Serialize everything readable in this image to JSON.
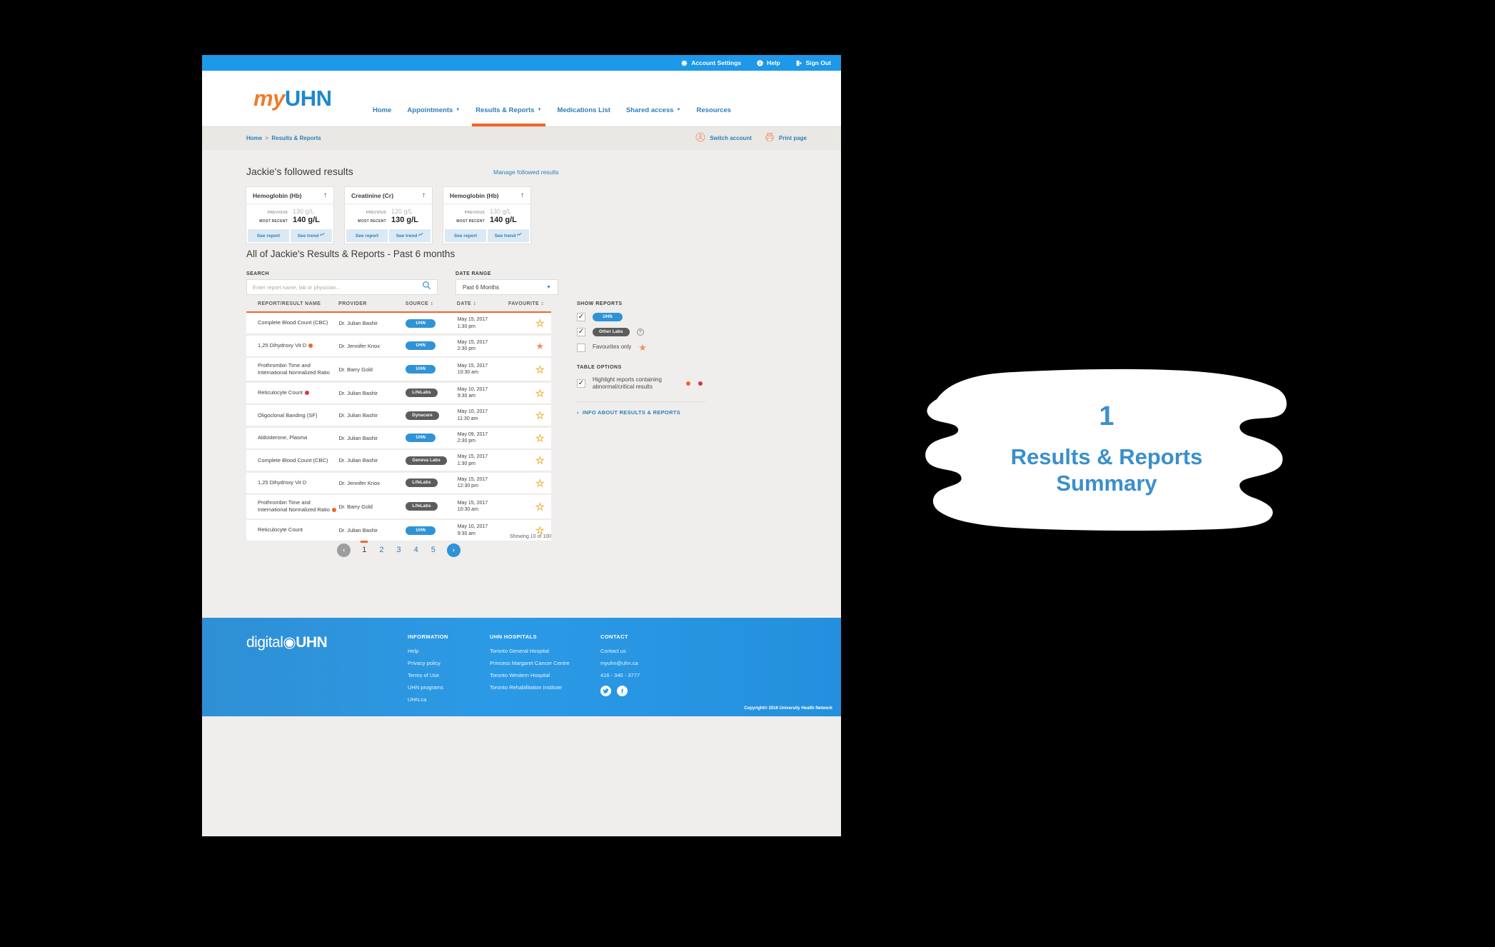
{
  "utility_bar": {
    "items": [
      {
        "label": "Account Settings",
        "icon": "gear-icon"
      },
      {
        "label": "Help",
        "icon": "info-icon"
      },
      {
        "label": "Sign Out",
        "icon": "sign-out-icon"
      }
    ]
  },
  "brand": {
    "prefix": "my",
    "suffix": "UHN"
  },
  "nav": {
    "items": [
      {
        "label": "Home",
        "caret": "",
        "active": false
      },
      {
        "label": "Appointments",
        "caret": "▼",
        "active": false
      },
      {
        "label": "Results & Reports",
        "caret": "▼",
        "active": true
      },
      {
        "label": "Medications List",
        "caret": "",
        "active": false
      },
      {
        "label": "Shared access",
        "caret": "▼",
        "active": false
      },
      {
        "label": "Resources",
        "caret": "",
        "active": false
      }
    ]
  },
  "breadcrumb": {
    "home": "Home",
    "separator": ">",
    "current": "Results & Reports"
  },
  "crumb_actions": [
    {
      "label": "Switch account",
      "icon": "user-circle-icon"
    },
    {
      "label": "Print page",
      "icon": "printer-icon"
    }
  ],
  "followed": {
    "heading": "Jackie's followed results",
    "manage_link": "Manage followed results",
    "labels": {
      "previous": "PREVIOUS",
      "most_recent": "MOST RECENT",
      "see_report": "See report",
      "see_trend": "See trend"
    },
    "cards": [
      {
        "title": "Hemoglobin (Hb)",
        "arrow": "↑",
        "previous": "130 g/L",
        "most_recent": "140 g/L"
      },
      {
        "title": "Creatinine (Cr)",
        "arrow": "↑",
        "previous": "120 g/L",
        "most_recent": "130 g/L"
      },
      {
        "title": "Hemoglobin (Hb)",
        "arrow": "↑",
        "previous": "130 g/L",
        "most_recent": "140 g/L"
      }
    ]
  },
  "results": {
    "heading": "All of Jackie's Results & Reports - Past 6 months",
    "search": {
      "label": "SEARCH",
      "placeholder": "Enter report name, lab or physician...",
      "value": "",
      "icon": "search-icon"
    },
    "date_range": {
      "label": "DATE RANGE",
      "value": "Past 6 Months",
      "options": [
        "Past 6 Months"
      ]
    },
    "columns": [
      {
        "label": "REPORT/RESULT NAME",
        "sortable": false
      },
      {
        "label": "PROVIDER",
        "sortable": false
      },
      {
        "label": "SOURCE",
        "sortable": true
      },
      {
        "label": "DATE",
        "sortable": true
      },
      {
        "label": "FAVOURITE",
        "sortable": true
      }
    ],
    "rows": [
      {
        "name": "Complete Blood Count (CBC)",
        "flag": "",
        "provider": "Dr. Julian Bashir",
        "source": "UHN",
        "source_type": "uhn",
        "date": "May 15, 2017",
        "time": "1:30 pm",
        "favourite": false
      },
      {
        "name": "1,25 Dihydroxy Vit D",
        "flag": "abnormal",
        "provider": "Dr. Jennifer Knox",
        "source": "UHN",
        "source_type": "uhn",
        "date": "May 15, 2017",
        "time": "2:30 pm",
        "favourite": true
      },
      {
        "name": "Prothrombin Time and International Normalized Ratio",
        "flag": "",
        "provider": "Dr. Barry Gold",
        "source": "UHN",
        "source_type": "uhn",
        "date": "May 15, 2017",
        "time": "10:30 am",
        "favourite": false
      },
      {
        "name": "Reticulocyte Count",
        "flag": "critical",
        "provider": "Dr. Julian Bashir",
        "source": "LifeLabs",
        "source_type": "other",
        "date": "May 10, 2017",
        "time": "9:30 am",
        "favourite": false
      },
      {
        "name": "Oligoclonal Banding (SF)",
        "flag": "",
        "provider": "Dr. Julian Bashir",
        "source": "Dynacare",
        "source_type": "other",
        "date": "May 10, 2017",
        "time": "11:30 am",
        "favourite": false
      },
      {
        "name": "Aldosterone, Plasma",
        "flag": "",
        "provider": "Dr. Julian Bashir",
        "source": "UHN",
        "source_type": "uhn",
        "date": "May 09, 2017",
        "time": "2:30 pm",
        "favourite": false
      },
      {
        "name": "Complete Blood Count (CBC)",
        "flag": "",
        "provider": "Dr. Julian Bashir",
        "source": "Geneva Labs",
        "source_type": "other",
        "date": "May 15, 2017",
        "time": "1:30 pm",
        "favourite": false
      },
      {
        "name": "1,25 Dihydroxy Vit D",
        "flag": "",
        "provider": "Dr. Jennifer Knox",
        "source": "LifeLabs",
        "source_type": "other",
        "date": "May 15, 2017",
        "time": "12:30 pm",
        "favourite": false
      },
      {
        "name": "Prothrombin Time and International Normalized Ratio",
        "flag": "abnormal",
        "provider": "Dr. Barry Gold",
        "source": "LifeLabs",
        "source_type": "other",
        "date": "May 15, 2017",
        "time": "10:30 am",
        "favourite": false
      },
      {
        "name": "Reticulocyte Count",
        "flag": "",
        "provider": "Dr. Julian Bashir",
        "source": "UHN",
        "source_type": "uhn",
        "date": "May 10, 2017",
        "time": "9:30 am",
        "favourite": false
      }
    ],
    "showing": "Showing 10 of 100",
    "pagination": {
      "prev": "‹",
      "next": "›",
      "pages": [
        "1",
        "2",
        "3",
        "4",
        "5"
      ],
      "active": "1"
    }
  },
  "rail": {
    "show_reports_heading": "SHOW REPORTS",
    "show_reports": [
      {
        "label": "UHN",
        "type": "badge-uhn",
        "checked": true
      },
      {
        "label": "Other Labs",
        "type": "badge-other",
        "checked": true,
        "help": "?"
      },
      {
        "label": "Favourites only",
        "type": "text-star",
        "checked": false
      }
    ],
    "table_options_heading": "TABLE OPTIONS",
    "table_options": [
      {
        "label": "Highlight reports containing abnormal/critical results",
        "checked": true
      }
    ],
    "info_link": "INFO ABOUT RESULTS & REPORTS",
    "info_chevron": "›"
  },
  "footer": {
    "logo_light": "digital",
    "logo_bold": "UHN",
    "columns": [
      {
        "heading": "INFORMATION",
        "links": [
          "Help",
          "Privacy policy",
          "Terms of Use",
          "UHN programs",
          "UHN.ca"
        ]
      },
      {
        "heading": "UHN HOSPITALS",
        "links": [
          "Toronto General Hospital",
          "Princess Margaret Cancer Centre",
          "Toronto Western Hospital",
          "Toronto Rehabilitation Institute"
        ]
      },
      {
        "heading": "CONTACT",
        "links": [
          "Contact us",
          "myuhn@uhn.ca",
          "416 - 340 - 3777"
        ]
      }
    ],
    "social": [
      {
        "name": "twitter-icon",
        "glyph": "🐦"
      },
      {
        "name": "facebook-icon",
        "glyph": "f"
      }
    ],
    "copyright": "Copyright© 2016 University Health Network"
  },
  "annotation": {
    "number": "1",
    "title_line1": "Results & Reports",
    "title_line2": "Summary"
  },
  "colors": {
    "brand_blue": "#1e88cc",
    "brand_orange": "#f07b29",
    "accent_orange": "#f0662a",
    "badge_uhn": "#2f93d6",
    "badge_other": "#5c5c5c",
    "abnormal_dot": "#f0662a",
    "critical_dot": "#d9344a",
    "star": "#f0b43e",
    "star_filled": "#f28e63",
    "page_bg": "#efeeec",
    "annotation_blue": "#3a8fcc"
  }
}
